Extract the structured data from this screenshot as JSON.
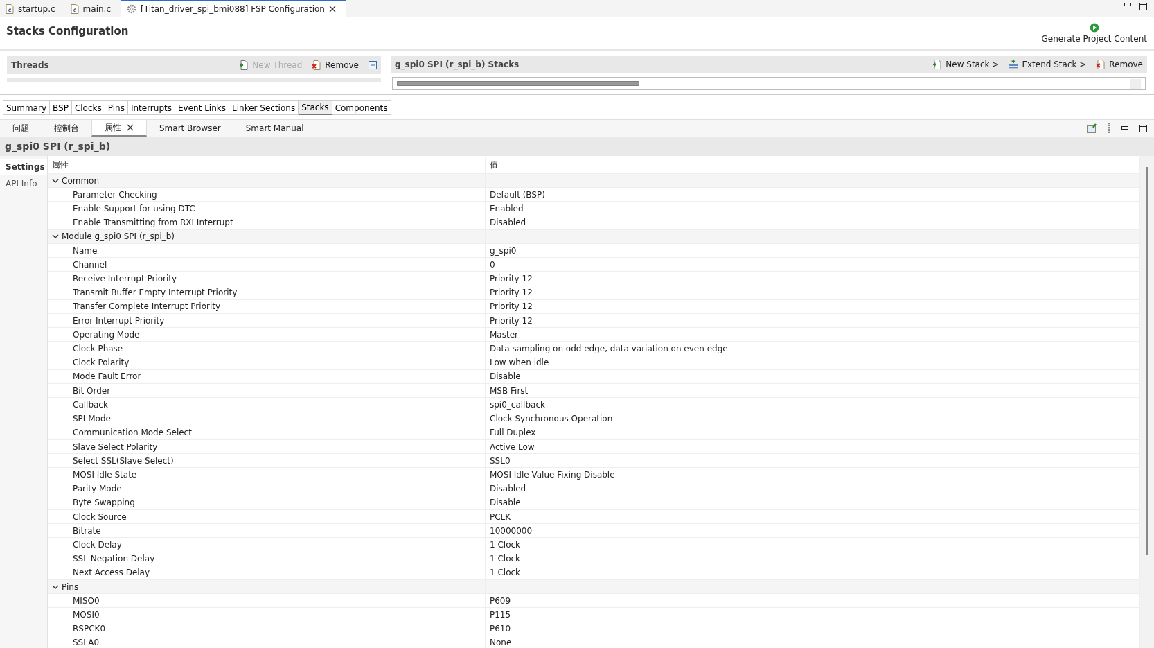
{
  "editor_tabs": [
    {
      "label": "startup.c",
      "kind": "c-file",
      "selected": false
    },
    {
      "label": "main.c",
      "kind": "c-file",
      "selected": false
    },
    {
      "label": "[Titan_driver_spi_bmi088] FSP Configuration",
      "kind": "config",
      "selected": true,
      "closable": true
    }
  ],
  "page_title": "Stacks Configuration",
  "generate_button": "Generate Project Content",
  "threads_panel": {
    "title": "Threads",
    "actions": [
      {
        "label": "New Thread",
        "kind": "new",
        "disabled": true
      },
      {
        "label": "Remove",
        "kind": "remove",
        "disabled": false
      }
    ]
  },
  "stacks_panel": {
    "title": "g_spi0 SPI (r_spi_b) Stacks",
    "actions": [
      {
        "label": "New Stack >",
        "kind": "new",
        "disabled": false
      },
      {
        "label": "Extend Stack >",
        "kind": "extend",
        "disabled": false
      },
      {
        "label": "Remove",
        "kind": "remove",
        "disabled": false
      }
    ]
  },
  "config_tabs": [
    {
      "label": "Summary",
      "selected": false
    },
    {
      "label": "BSP",
      "selected": false
    },
    {
      "label": "Clocks",
      "selected": false
    },
    {
      "label": "Pins",
      "selected": false
    },
    {
      "label": "Interrupts",
      "selected": false
    },
    {
      "label": "Event Links",
      "selected": false
    },
    {
      "label": "Linker Sections",
      "selected": false
    },
    {
      "label": "Stacks",
      "selected": true
    },
    {
      "label": "Components",
      "selected": false
    }
  ],
  "view_tabs": [
    {
      "label": "问题",
      "selected": false,
      "closable": false
    },
    {
      "label": "控制台",
      "selected": false,
      "closable": false
    },
    {
      "label": "属性",
      "selected": true,
      "closable": true
    },
    {
      "label": "Smart Browser",
      "selected": false,
      "closable": false
    },
    {
      "label": "Smart Manual",
      "selected": false,
      "closable": false
    }
  ],
  "properties_title": "g_spi0 SPI (r_spi_b)",
  "side_tabs": [
    {
      "label": "Settings",
      "selected": true
    },
    {
      "label": "API Info",
      "selected": false
    }
  ],
  "table": {
    "columns": [
      "属性",
      "值"
    ],
    "rows": [
      {
        "property": "Common",
        "expanded": true,
        "children": [
          {
            "property": "Parameter Checking",
            "value": "Default (BSP)"
          },
          {
            "property": "Enable Support for using DTC",
            "value": "Enabled"
          },
          {
            "property": "Enable Transmitting from RXI Interrupt",
            "value": "Disabled"
          }
        ]
      },
      {
        "property": "Module g_spi0 SPI (r_spi_b)",
        "expanded": true,
        "children": [
          {
            "property": "Name",
            "value": "g_spi0"
          },
          {
            "property": "Channel",
            "value": "0"
          },
          {
            "property": "Receive Interrupt Priority",
            "value": "Priority 12"
          },
          {
            "property": "Transmit Buffer Empty Interrupt Priority",
            "value": "Priority 12"
          },
          {
            "property": "Transfer Complete Interrupt Priority",
            "value": "Priority 12"
          },
          {
            "property": "Error Interrupt Priority",
            "value": "Priority 12"
          },
          {
            "property": "Operating Mode",
            "value": "Master"
          },
          {
            "property": "Clock Phase",
            "value": "Data sampling on odd edge, data variation on even edge"
          },
          {
            "property": "Clock Polarity",
            "value": "Low when idle"
          },
          {
            "property": "Mode Fault Error",
            "value": "Disable"
          },
          {
            "property": "Bit Order",
            "value": "MSB First"
          },
          {
            "property": "Callback",
            "value": "spi0_callback"
          },
          {
            "property": "SPI Mode",
            "value": "Clock Synchronous Operation"
          },
          {
            "property": "Communication Mode Select",
            "value": "Full Duplex"
          },
          {
            "property": "Slave Select Polarity",
            "value": "Active Low"
          },
          {
            "property": "Select SSL(Slave Select)",
            "value": "SSL0"
          },
          {
            "property": "MOSI Idle State",
            "value": "MOSI Idle Value Fixing Disable"
          },
          {
            "property": "Parity Mode",
            "value": "Disabled"
          },
          {
            "property": "Byte Swapping",
            "value": "Disable"
          },
          {
            "property": "Clock Source",
            "value": "PCLK"
          },
          {
            "property": "Bitrate",
            "value": "10000000"
          },
          {
            "property": "Clock Delay",
            "value": "1 Clock"
          },
          {
            "property": "SSL Negation Delay",
            "value": "1 Clock"
          },
          {
            "property": "Next Access Delay",
            "value": "1 Clock"
          }
        ]
      },
      {
        "property": "Pins",
        "expanded": true,
        "children": [
          {
            "property": "MISO0",
            "value": "P609"
          },
          {
            "property": "MOSI0",
            "value": "P115"
          },
          {
            "property": "RSPCK0",
            "value": "P610"
          },
          {
            "property": "SSLA0",
            "value": "None"
          }
        ]
      }
    ]
  }
}
